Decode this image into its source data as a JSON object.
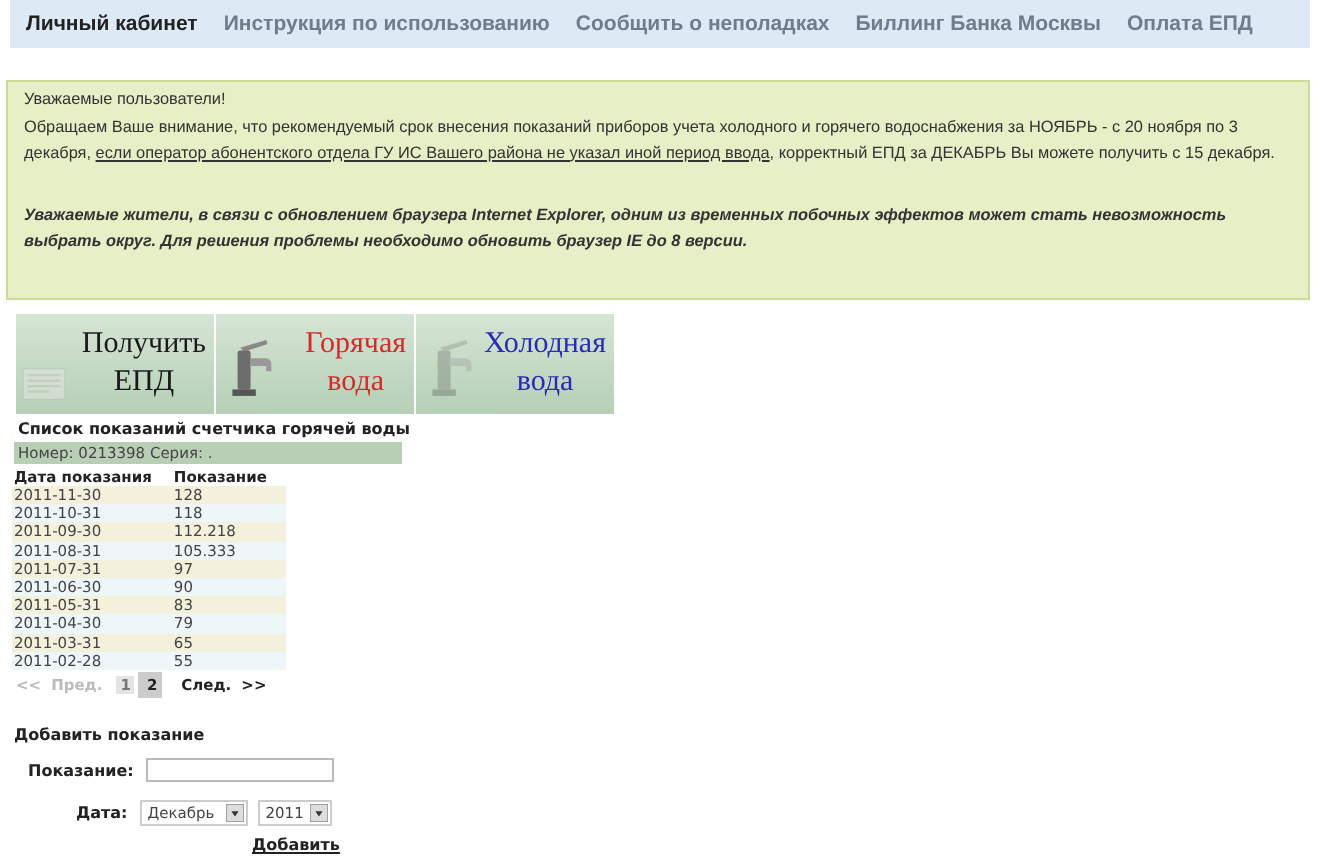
{
  "nav": [
    {
      "label": "Личный кабинет",
      "selected": true
    },
    {
      "label": "Инструкция по использованию",
      "selected": false
    },
    {
      "label": "Сообщить о неполадках",
      "selected": false
    },
    {
      "label": "Биллинг Банка Москвы",
      "selected": false
    },
    {
      "label": "Оплата ЕПД",
      "selected": false
    }
  ],
  "notice": {
    "greeting": "Уважаемые пользователи!",
    "text_before": "Обращаем Ваше внимание, что рекомендуемый срок внесения показаний приборов учета холодного и горячего водоснабжения за НОЯБРЬ - с 20 ноября по 3 декабря,",
    "link": "если оператор абонентского отдела ГУ ИС Вашего района не указал иной период ввода",
    "text_after": ", корректный ЕПД за ДЕКАБРЬ Вы можете получить с 15 декабря.",
    "warning": "Уважаемые жители, в связи с обновлением браузера Internet Explorer, одним из временных побочных эффектов может стать невозможность выбрать округ. Для решения проблемы необходимо обновить браузер IE до 8 версии."
  },
  "banners": [
    {
      "kind": "document",
      "line1": "Получить",
      "line2": "ЕПД",
      "color": "#1a1a1a"
    },
    {
      "kind": "hot",
      "line1": "Горячая",
      "line2": "вода",
      "color": "#d42a2a"
    },
    {
      "kind": "cold",
      "line1": "Холодная",
      "line2": "вода",
      "color": "#2a2ab8"
    }
  ],
  "list_title": "Список показаний счетчика горячей воды",
  "meter": "Номер: 0213398 Серия: .",
  "table": {
    "columns": [
      "Дата показания",
      "Показание"
    ],
    "rows": [
      [
        "2011-11-30",
        "128"
      ],
      [
        "2011-10-31",
        "118"
      ],
      [
        "2011-09-30",
        "112.218"
      ],
      [
        "2011-08-31",
        "105.333"
      ],
      [
        "2011-07-31",
        "97"
      ],
      [
        "2011-06-30",
        "90"
      ],
      [
        "2011-05-31",
        "83"
      ],
      [
        "2011-04-30",
        "79"
      ],
      [
        "2011-03-31",
        "65"
      ],
      [
        "2011-02-28",
        "55"
      ]
    ]
  },
  "pager": {
    "first": {
      "label": "<<",
      "disabled": true
    },
    "prev": {
      "label": "Пред.",
      "disabled": true
    },
    "pages": [
      {
        "label": "1",
        "selected": false
      },
      {
        "label": "2",
        "selected": true
      }
    ],
    "next": {
      "label": "След.",
      "disabled": false
    },
    "last": {
      "label": ">>",
      "disabled": false
    }
  },
  "form": {
    "title": "Добавить показание",
    "reading_label": "Показание:",
    "date_label": "Дата:",
    "month": "Декабрь",
    "year": "2011",
    "submit": "Добавить"
  }
}
